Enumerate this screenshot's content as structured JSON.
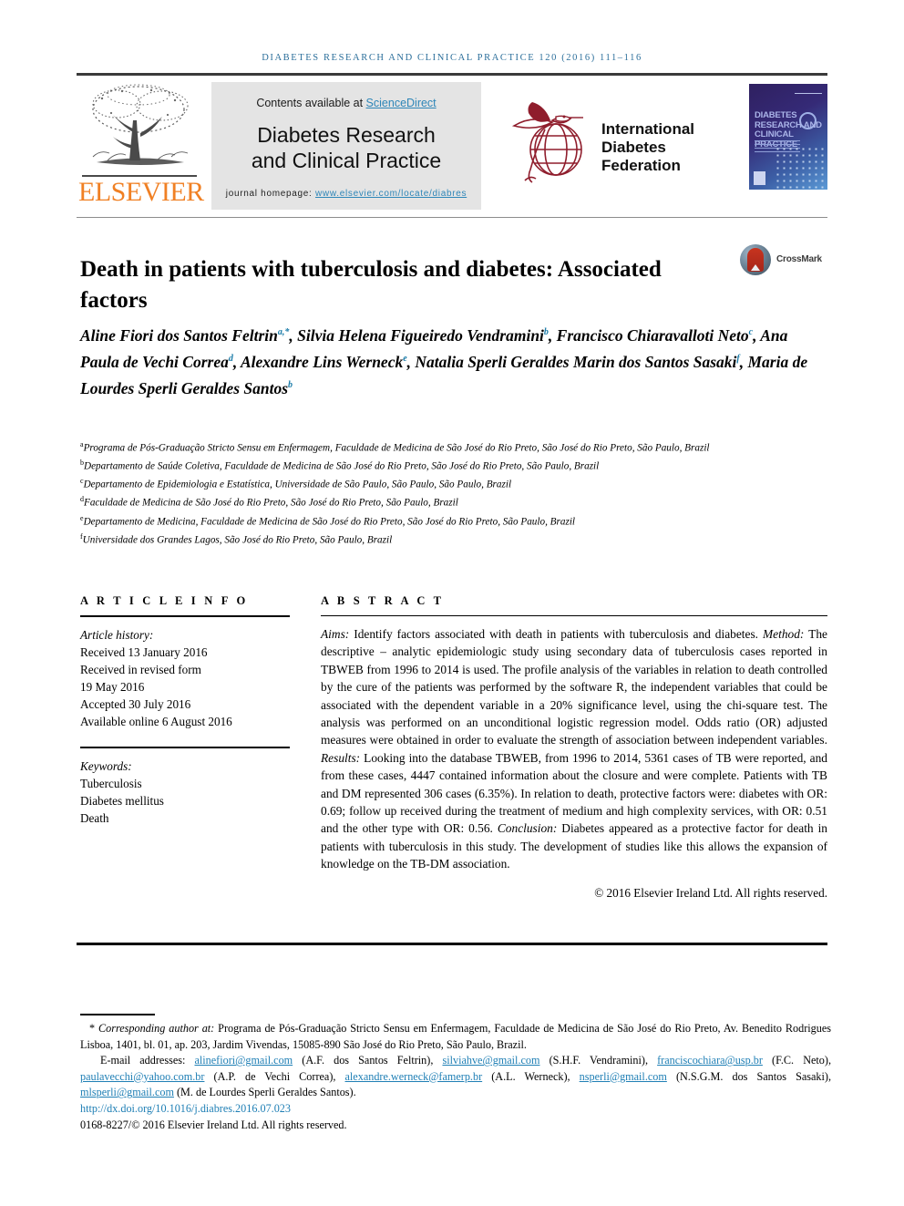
{
  "running_head": "Diabetes research and clinical practice 120 (2016) 111–116",
  "masthead": {
    "publisher_wordmark": "ELSEVIER",
    "contents_prefix": "Contents available at ",
    "contents_link": "ScienceDirect",
    "journal_title_line1": "Diabetes Research",
    "journal_title_line2": "and Clinical Practice",
    "homepage_label": "journal homepage: ",
    "homepage_url": "www.elsevier.com/locate/diabres",
    "idf_line1": "International",
    "idf_line2": "Diabetes",
    "idf_line3": "Federation",
    "cover_title_line1": "DIABETES",
    "cover_title_line2": "RESEARCH AND",
    "cover_title_line3": "CLINICAL PRACTICE"
  },
  "article": {
    "title": "Death in patients with tuberculosis and diabetes: Associated factors",
    "crossmark_label": "CrossMark"
  },
  "authors_html": "Aline Fiori dos Santos Feltrin<sup>a,*</sup>, Silvia Helena Figueiredo Vendramini<sup>b</sup>, Francisco Chiaravalloti Neto<sup>c</sup>, Ana Paula de Vechi Correa<sup>d</sup>, Alexandre Lins Werneck<sup>e</sup>, Natalia Sperli Geraldes Marin dos Santos Sasaki<sup>f</sup>, Maria de Lourdes Sperli Geraldes Santos<sup>b</sup>",
  "affiliations": [
    {
      "marker": "a",
      "text": "Programa de Pós-Graduação Stricto Sensu em Enfermagem, Faculdade de Medicina de São José do Rio Preto, São José do Rio Preto, São Paulo, Brazil"
    },
    {
      "marker": "b",
      "text": "Departamento de Saúde Coletiva, Faculdade de Medicina de São José do Rio Preto, São José do Rio Preto, São Paulo, Brazil"
    },
    {
      "marker": "c",
      "text": "Departamento de Epidemiologia e Estatística, Universidade de São Paulo, São Paulo, São Paulo, Brazil"
    },
    {
      "marker": "d",
      "text": "Faculdade de Medicina de São José do Rio Preto, São José do Rio Preto, São Paulo, Brazil"
    },
    {
      "marker": "e",
      "text": "Departamento de Medicina, Faculdade de Medicina de São José do Rio Preto, São José do Rio Preto, São Paulo, Brazil"
    },
    {
      "marker": "f",
      "text": "Universidade dos Grandes Lagos, São José do Rio Preto, São Paulo, Brazil"
    }
  ],
  "article_info": {
    "heading": "A R T I C L E  I N F O",
    "history_label": "Article history:",
    "history": [
      "Received 13 January 2016",
      "Received in revised form",
      "19 May 2016",
      "Accepted 30 July 2016",
      "Available online 6 August 2016"
    ],
    "keywords_label": "Keywords:",
    "keywords": [
      "Tuberculosis",
      "Diabetes mellitus",
      "Death"
    ]
  },
  "abstract": {
    "heading": "A B S T R A C T",
    "sections": [
      {
        "label": "Aims:",
        "text": " Identify factors associated with death in patients with tuberculosis and diabetes."
      },
      {
        "label": "Method:",
        "text": " The descriptive – analytic epidemiologic study using secondary data of tuberculosis cases reported in TBWEB from 1996 to 2014 is used. The profile analysis of the variables in relation to death controlled by the cure of the patients was performed by the software R, the independent variables that could be associated with the dependent variable in a 20% significance level, using the chi-square test. The analysis was performed on an unconditional logistic regression model. Odds ratio (OR) adjusted measures were obtained in order to evaluate the strength of association between independent variables."
      },
      {
        "label": "Results:",
        "text": " Looking into the database TBWEB, from 1996 to 2014, 5361 cases of TB were reported, and from these cases, 4447 contained information about the closure and were complete. Patients with TB and DM represented 306 cases (6.35%). In relation to death, protective factors were: diabetes with OR: 0.69; follow up received during the treatment of medium and high complexity services, with OR: 0.51 and the other type with OR: 0.56."
      },
      {
        "label": "Conclusion:",
        "text": " Diabetes appeared as a protective factor for death in patients with tuberculosis in this study. The development of studies like this allows the expansion of knowledge on the TB-DM association."
      }
    ],
    "copyright": "© 2016 Elsevier Ireland Ltd. All rights reserved."
  },
  "footnotes": {
    "corresponding_label": "Corresponding author at:",
    "corresponding_text": " Programa de Pós-Graduação Stricto Sensu em Enfermagem, Faculdade de Medicina de São José do Rio Preto, Av. Benedito Rodrigues Lisboa, 1401, bl. 01, ap. 203, Jardim Vivendas, 15085-890 São José do Rio Preto, São Paulo, Brazil.",
    "email_label": "E-mail addresses:",
    "emails": [
      {
        "address": "alinefiori@gmail.com",
        "person": "(A.F. dos Santos Feltrin)"
      },
      {
        "address": "silviahve@gmail.com",
        "person": "(S.H.F. Vendramini)"
      },
      {
        "address": "franciscochiara@usp.br",
        "person": "(F.C. Neto)"
      },
      {
        "address": "paulavecchi@yahoo.com.br",
        "person": "(A.P. de Vechi Correa)"
      },
      {
        "address": "alexandre.werneck@famerp.br",
        "person": "(A.L. Werneck)"
      },
      {
        "address": "nsperli@gmail.com",
        "person": "(N.S.G.M. dos Santos Sasaki)"
      },
      {
        "address": "mlsperli@gmail.com",
        "person": "(M. de Lourdes Sperli Geraldes Santos)"
      }
    ],
    "doi": "http://dx.doi.org/10.1016/j.diabres.2016.07.023",
    "issn_line": "0168-8227/© 2016 Elsevier Ireland Ltd. All rights reserved."
  },
  "colors": {
    "elsevier_orange": "#f08024",
    "link_blue": "#2e86b8",
    "runhead_blue": "#2c6f9b",
    "idf_red": "#8f1d2c",
    "banner_gray": "#e4e4e4"
  }
}
